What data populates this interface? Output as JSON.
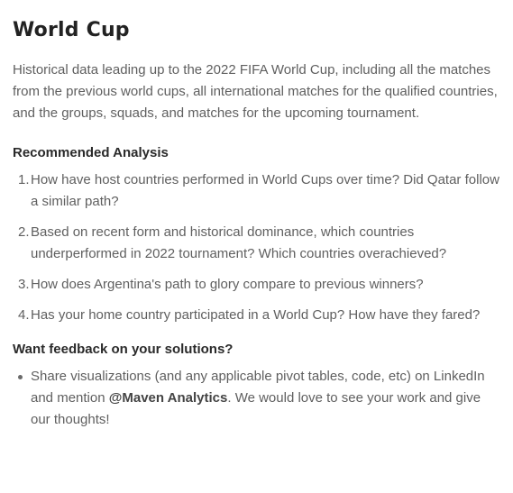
{
  "title": "World Cup",
  "intro": "Historical data leading up to the 2022 FIFA World Cup, including all the matches from the previous world cups, all international matches for the qualified countries, and the groups, squads, and matches for the upcoming tournament.",
  "recommended": {
    "heading": "Recommended Analysis",
    "items": [
      {
        "num": "1.",
        "text": "How have host countries performed in World Cups over time? Did Qatar follow a similar path?"
      },
      {
        "num": "2.",
        "text": "Based on recent form and historical dominance, which countries underperformed in 2022 tournament? Which countries overachieved?"
      },
      {
        "num": "3.",
        "text": "How does Argentina's path to glory compare to previous winners?"
      },
      {
        "num": "4.",
        "text": "Has your home country participated in a World Cup? How have they fared?"
      }
    ]
  },
  "feedback": {
    "heading": "Want feedback on your solutions?",
    "text_before": "Share visualizations (and any applicable pivot tables, code, etc) on LinkedIn and mention ",
    "mention": "@Maven Analytics",
    "text_after": ". We would love to see your work and give our thoughts!"
  }
}
